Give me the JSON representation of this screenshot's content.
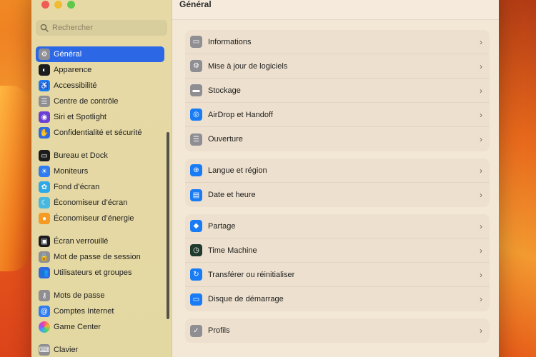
{
  "window": {
    "title": "Général"
  },
  "search": {
    "placeholder": "Rechercher"
  },
  "sidebar": {
    "groups": [
      [
        {
          "label": "Général",
          "icon": "gear-icon",
          "color": "#8e8e93",
          "glyph": "⚙",
          "active": true
        },
        {
          "label": "Apparence",
          "icon": "appearance-icon",
          "color": "#1c1c1e",
          "glyph": "◐"
        },
        {
          "label": "Accessibilité",
          "icon": "accessibility-icon",
          "color": "#1a7cf5",
          "glyph": "♿"
        },
        {
          "label": "Centre de contrôle",
          "icon": "control-center-icon",
          "color": "#8e8e93",
          "glyph": "☰"
        },
        {
          "label": "Siri et Spotlight",
          "icon": "siri-icon",
          "color": "#6b3fd4",
          "glyph": "◉"
        },
        {
          "label": "Confidentialité et sécurité",
          "icon": "privacy-hand-icon",
          "color": "#2f6be0",
          "glyph": "✋"
        }
      ],
      [
        {
          "label": "Bureau et Dock",
          "icon": "dock-icon",
          "color": "#1c1c1e",
          "glyph": "▭"
        },
        {
          "label": "Moniteurs",
          "icon": "display-icon",
          "color": "#2f7cf0",
          "glyph": "☀"
        },
        {
          "label": "Fond d’écran",
          "icon": "wallpaper-icon",
          "color": "#2ea8e8",
          "glyph": "✿"
        },
        {
          "label": "Économiseur d’écran",
          "icon": "screensaver-icon",
          "color": "#48b8e0",
          "glyph": "☾"
        },
        {
          "label": "Économiseur d’énergie",
          "icon": "energy-bulb-icon",
          "color": "#f59a24",
          "glyph": "●"
        }
      ],
      [
        {
          "label": "Écran verrouillé",
          "icon": "lock-screen-icon",
          "color": "#1c1c1e",
          "glyph": "▣"
        },
        {
          "label": "Mot de passe de session",
          "icon": "lock-icon",
          "color": "#8e8e93",
          "glyph": "🔒"
        },
        {
          "label": "Utilisateurs et groupes",
          "icon": "users-icon",
          "color": "#2f6be0",
          "glyph": "👥"
        }
      ],
      [
        {
          "label": "Mots de passe",
          "icon": "key-icon",
          "color": "#8e8e93",
          "glyph": "⚷"
        },
        {
          "label": "Comptes Internet",
          "icon": "at-icon",
          "color": "#2f7cf0",
          "glyph": "@"
        },
        {
          "label": "Game Center",
          "icon": "game-center-icon",
          "color": "#ffffff",
          "glyph": "●"
        }
      ],
      [
        {
          "label": "Clavier",
          "icon": "keyboard-icon",
          "color": "#8e8e93",
          "glyph": "⌨"
        }
      ]
    ]
  },
  "main": {
    "groups": [
      [
        {
          "label": "Informations",
          "icon": "info-computer-icon",
          "color": "#8e8e93",
          "glyph": "▭"
        },
        {
          "label": "Mise à jour de logiciels",
          "icon": "software-update-icon",
          "color": "#8e8e93",
          "glyph": "⚙"
        },
        {
          "label": "Stockage",
          "icon": "storage-icon",
          "color": "#8e8e93",
          "glyph": "▬"
        },
        {
          "label": "AirDrop et Handoff",
          "icon": "airdrop-icon",
          "color": "#1a7cf5",
          "glyph": "◎"
        },
        {
          "label": "Ouverture",
          "icon": "login-items-icon",
          "color": "#8e8e93",
          "glyph": "☰"
        }
      ],
      [
        {
          "label": "Langue et région",
          "icon": "globe-icon",
          "color": "#1a7cf5",
          "glyph": "⊕"
        },
        {
          "label": "Date et heure",
          "icon": "calendar-clock-icon",
          "color": "#1a7cf5",
          "glyph": "▤"
        }
      ],
      [
        {
          "label": "Partage",
          "icon": "sharing-icon",
          "color": "#1a7cf5",
          "glyph": "◆"
        },
        {
          "label": "Time Machine",
          "icon": "time-machine-icon",
          "color": "#1f3b2e",
          "glyph": "◷"
        },
        {
          "label": "Transférer ou réinitialiser",
          "icon": "reset-icon",
          "color": "#1a7cf5",
          "glyph": "↻"
        },
        {
          "label": "Disque de démarrage",
          "icon": "startup-disk-icon",
          "color": "#1a7cf5",
          "glyph": "▭"
        }
      ],
      [
        {
          "label": "Profils",
          "icon": "profiles-check-icon",
          "color": "#8e8e93",
          "glyph": "✓"
        }
      ]
    ]
  }
}
